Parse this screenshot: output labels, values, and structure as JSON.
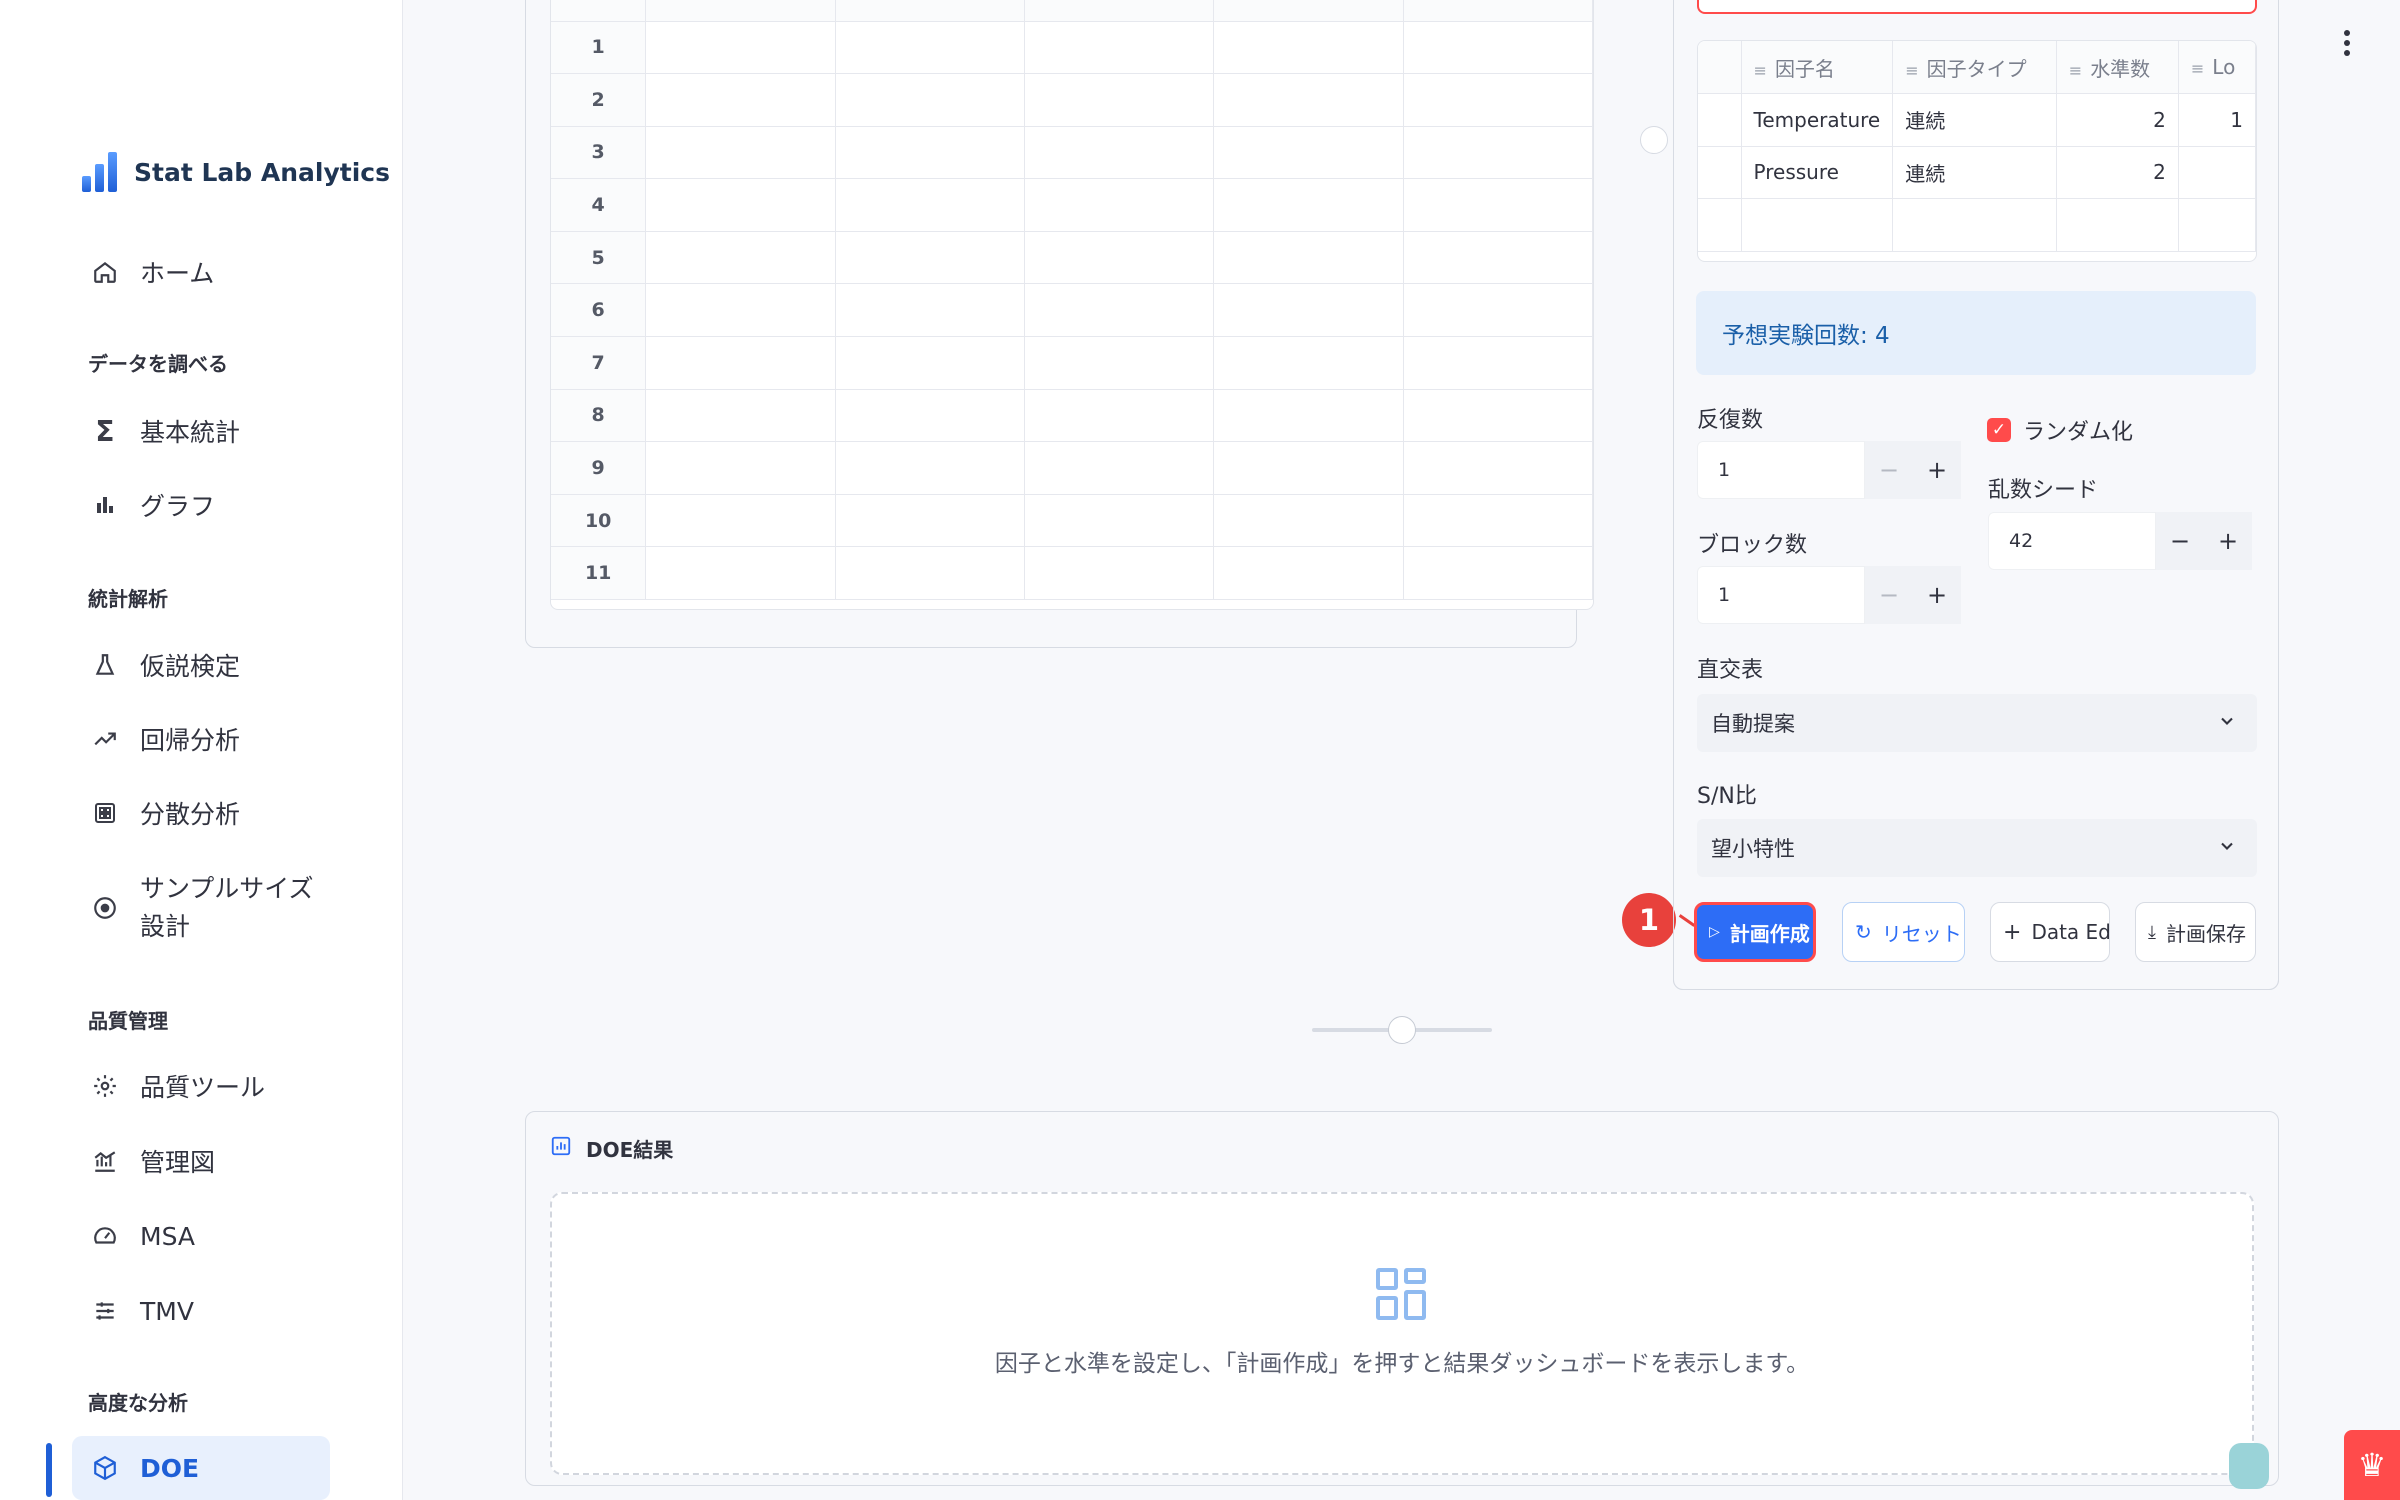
{
  "app": {
    "title": "Stat Lab Analytics"
  },
  "sidebar": {
    "home": "ホーム",
    "sections": {
      "explore": "データを調べる",
      "stats": "統計解析",
      "quality": "品質管理",
      "advanced": "高度な分析"
    },
    "items": {
      "basic_stats": "基本統計",
      "graph": "グラフ",
      "hypothesis": "仮説検定",
      "regression": "回帰分析",
      "anova": "分散分析",
      "sample_size_1": "サンプルサイズ",
      "sample_size_2": "設計",
      "quality_tools": "品質ツール",
      "control_chart": "管理図",
      "msa": "MSA",
      "tmv": "TMV",
      "doe": "DOE"
    }
  },
  "data_grid": {
    "row_numbers": [
      "1",
      "2",
      "3",
      "4",
      "5",
      "6",
      "7",
      "8",
      "9",
      "10",
      "11"
    ]
  },
  "factor_table": {
    "headers": [
      "因子名",
      "因子タイプ",
      "水準数",
      "Lo"
    ],
    "rows": [
      {
        "name": "Temperature",
        "type": "連続",
        "levels": "2",
        "low": "1"
      },
      {
        "name": "Pressure",
        "type": "連続",
        "levels": "2",
        "low": ""
      }
    ]
  },
  "expected_runs": "予想実験回数: 4",
  "replicates": {
    "label": "反復数",
    "value": "1"
  },
  "blocks": {
    "label": "ブロック数",
    "value": "1"
  },
  "randomize": {
    "label": "ランダム化",
    "checked": true
  },
  "seed": {
    "label": "乱数シード",
    "value": "42"
  },
  "orthogonal": {
    "label": "直交表",
    "selected": "自動提案"
  },
  "sn_ratio": {
    "label": "S/N比",
    "selected": "望小特性"
  },
  "buttons": {
    "create": "計画作成",
    "reset": "リセット",
    "editor": "Data Editor",
    "save": "計画保存"
  },
  "annotation_badge": "1",
  "results": {
    "title": "DOE結果",
    "empty_message": "因子と水準を設定し、「計画作成」を押すと結果ダッシュボードを表示します。"
  },
  "colors": {
    "accent": "#2d6df6",
    "danger": "#ff4b4b",
    "info_bg": "#e5effb"
  }
}
